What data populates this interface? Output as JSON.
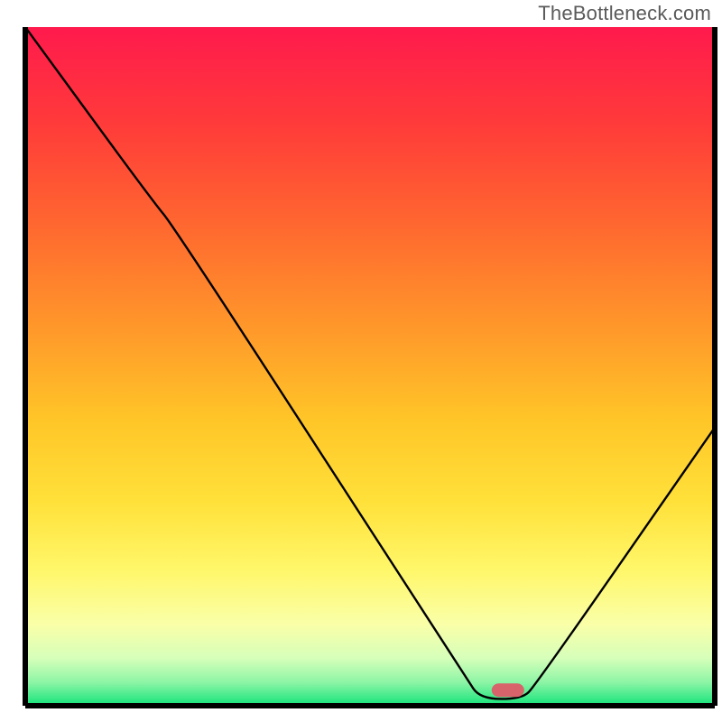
{
  "attribution": "TheBottleneck.com",
  "chart_data": {
    "type": "line",
    "title": "",
    "xlabel": "",
    "ylabel": "",
    "x_range": [
      0,
      100
    ],
    "y_range": [
      0,
      100
    ],
    "curve": {
      "name": "bottleneck-curve",
      "points": [
        {
          "x": 0,
          "y": 100
        },
        {
          "x": 18,
          "y": 75
        },
        {
          "x": 22,
          "y": 70
        },
        {
          "x": 64,
          "y": 4
        },
        {
          "x": 66,
          "y": 1
        },
        {
          "x": 72,
          "y": 1
        },
        {
          "x": 74,
          "y": 3
        },
        {
          "x": 100,
          "y": 41
        }
      ]
    },
    "optimum_marker": {
      "x": 70,
      "y": 2.3,
      "color": "#d9636b"
    },
    "background_gradient_stops": [
      {
        "offset": 0.0,
        "color": "#ff1a4d"
      },
      {
        "offset": 0.14,
        "color": "#ff3a3a"
      },
      {
        "offset": 0.3,
        "color": "#ff6a2f"
      },
      {
        "offset": 0.45,
        "color": "#ff9a2a"
      },
      {
        "offset": 0.58,
        "color": "#ffc628"
      },
      {
        "offset": 0.7,
        "color": "#ffe13a"
      },
      {
        "offset": 0.8,
        "color": "#fff76a"
      },
      {
        "offset": 0.88,
        "color": "#faffa8"
      },
      {
        "offset": 0.93,
        "color": "#d6ffba"
      },
      {
        "offset": 0.965,
        "color": "#8ef5a6"
      },
      {
        "offset": 1.0,
        "color": "#14e37a"
      }
    ],
    "axis_visible": true,
    "grid": false
  }
}
